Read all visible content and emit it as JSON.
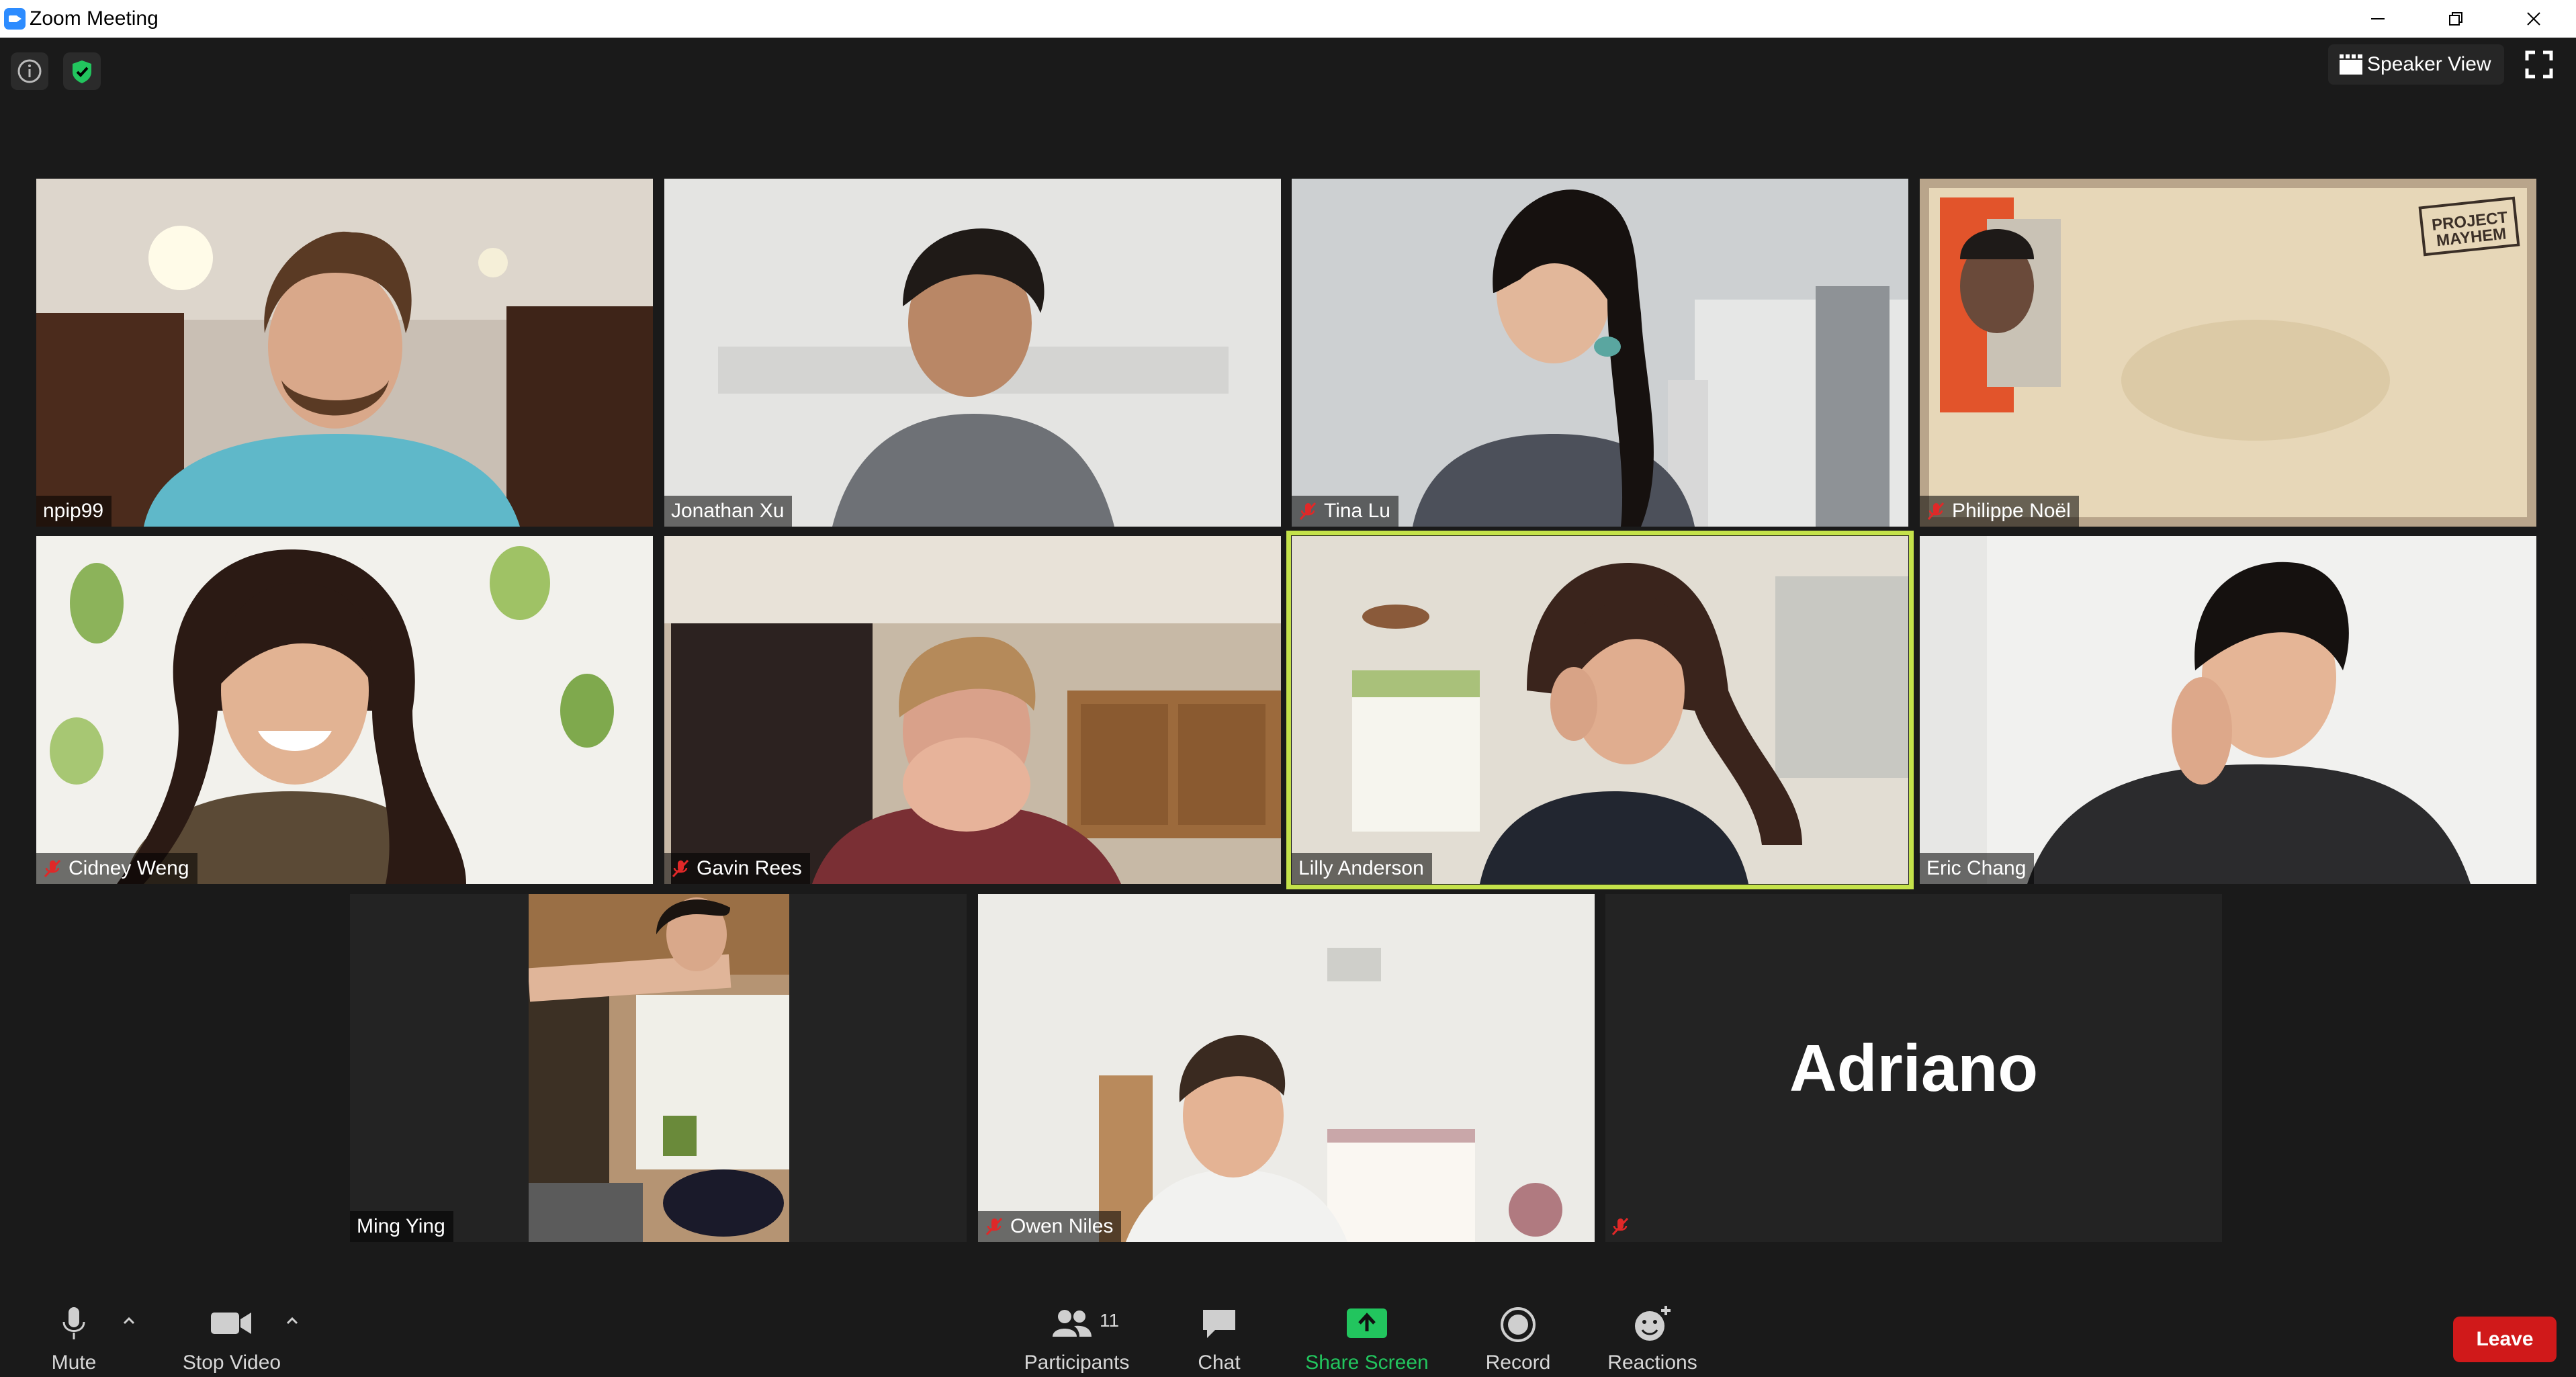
{
  "window": {
    "title": "Zoom Meeting"
  },
  "header": {
    "view_label": "Speaker View"
  },
  "participants": {
    "npip99": "npip99",
    "jonathan": "Jonathan Xu",
    "tina": "Tina Lu",
    "philippe": "Philippe Noël",
    "cidney": "Cidney Weng",
    "gavin": "Gavin Rees",
    "lilly": "Lilly Anderson",
    "eric": "Eric Chang",
    "ming": "Ming Ying",
    "owen": "Owen Niles",
    "adriano": "Adriano"
  },
  "background_art": {
    "poster_text": "PROJECT MAYHEM"
  },
  "toolbar": {
    "mute": "Mute",
    "stop_video": "Stop Video",
    "participants": "Participants",
    "participant_count": "11",
    "chat": "Chat",
    "share_screen": "Share Screen",
    "record": "Record",
    "reactions": "Reactions",
    "leave": "Leave"
  },
  "colors": {
    "active_speaker_border": "#c4e24a",
    "share_screen": "#22c55e",
    "leave": "#d0191a",
    "security_shield": "#22c55e"
  }
}
